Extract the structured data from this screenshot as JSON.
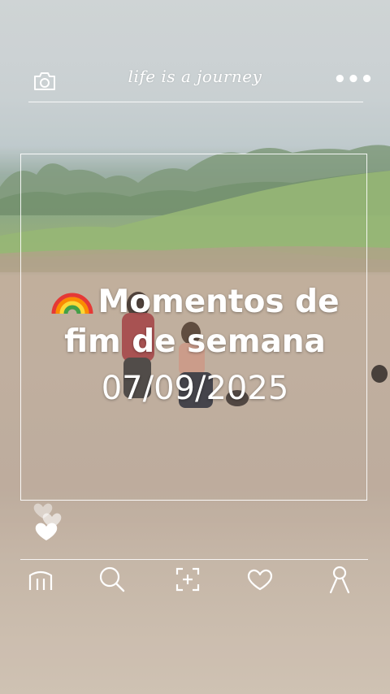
{
  "header": {
    "brand_text": "life is a journey",
    "camera_icon": "camera-icon",
    "more_icon": "more-dots-icon",
    "more_label": "•••"
  },
  "post": {
    "caption_emoji": "rainbow-icon",
    "caption_line1": "Momentos de",
    "caption_line2": "fim de semana",
    "caption_date": "07/09/2025"
  },
  "bottom_nav": {
    "items": [
      {
        "name": "home",
        "icon": "home-icon"
      },
      {
        "name": "search",
        "icon": "search-icon"
      },
      {
        "name": "add",
        "icon": "add-photo-icon"
      },
      {
        "name": "likes",
        "icon": "heart-icon"
      },
      {
        "name": "profile",
        "icon": "profile-icon"
      }
    ]
  },
  "colors": {
    "overlay_ui": "#ffffff",
    "water": "#b8a492",
    "grass": "#7d9d74"
  }
}
